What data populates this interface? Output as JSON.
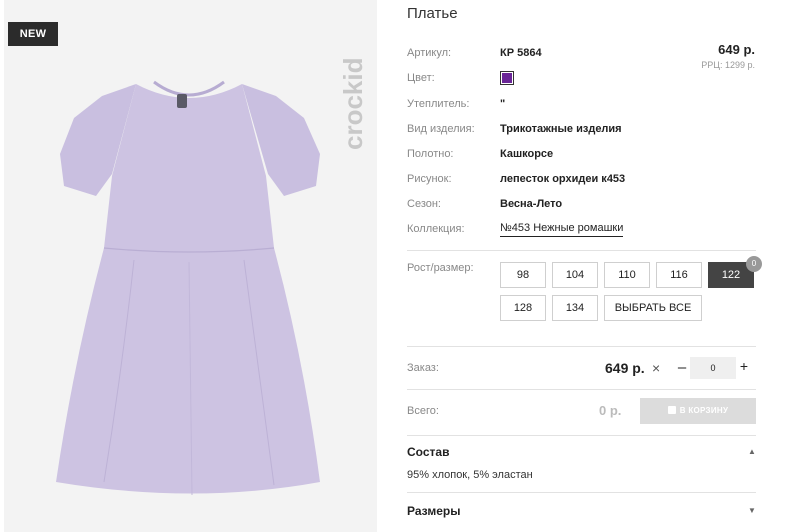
{
  "image": {
    "badge": "NEW",
    "brand_watermark": "crockid",
    "dress_color": "#cdc3e2"
  },
  "product": {
    "title": "Платье",
    "price": "649 р.",
    "rrp": "РРЦ: 1299 р.",
    "attributes": [
      {
        "label": "Артикул:",
        "value": "КР 5864"
      },
      {
        "label": "Цвет:",
        "value": "#6a2597"
      },
      {
        "label": "Утеплитель:",
        "value": "\""
      },
      {
        "label": "Вид изделия:",
        "value": "Трикотажные изделия"
      },
      {
        "label": "Полотно:",
        "value": "Кашкорсе"
      },
      {
        "label": "Рисунок:",
        "value": "лепесток орхидеи к453"
      },
      {
        "label": "Сезон:",
        "value": "Весна-Лето"
      },
      {
        "label": "Коллекция:",
        "value": "№453 Нежные ромашки"
      }
    ]
  },
  "sizes": {
    "label": "Рост/размер:",
    "options": [
      "98",
      "104",
      "110",
      "116",
      "122",
      "128",
      "134"
    ],
    "selected": "122",
    "selected_count": "0",
    "select_all_label": "ВЫБРАТЬ ВСЕ"
  },
  "order": {
    "label": "Заказ:",
    "unit_price": "649 р.",
    "multiply": "×",
    "minus": "–",
    "quantity": "0",
    "plus": "+"
  },
  "total": {
    "label": "Всего:",
    "value": "0 р.",
    "cart_button": "В КОРЗИНУ"
  },
  "sections": [
    {
      "title": "Состав",
      "content": "95% хлопок, 5% эластан",
      "expanded": true
    },
    {
      "title": "Размеры",
      "content": "",
      "expanded": false
    }
  ],
  "colors": {
    "accent_dark": "#444444",
    "swatch": "#6a2597",
    "disabled_button": "#dcdcdc"
  }
}
